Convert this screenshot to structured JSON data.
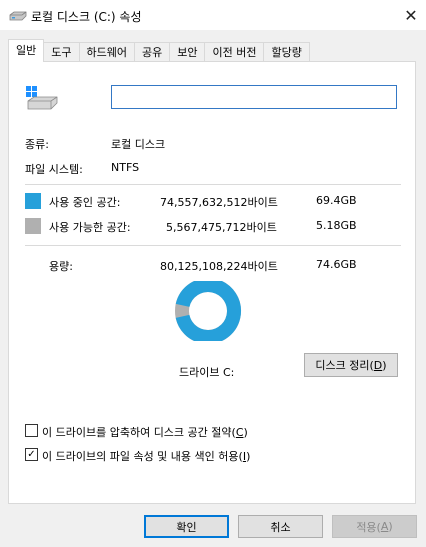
{
  "window": {
    "title": "로컬 디스크 (C:) 속성",
    "close_glyph": "✕"
  },
  "tabs": [
    {
      "label": "일반",
      "active": true
    },
    {
      "label": "도구"
    },
    {
      "label": "하드웨어"
    },
    {
      "label": "공유"
    },
    {
      "label": "보안"
    },
    {
      "label": "이전 버전"
    },
    {
      "label": "할당량"
    }
  ],
  "icons": {
    "title": "drive-icon",
    "drive": "windows-drive-icon",
    "close": "close-icon"
  },
  "name_field": {
    "value": ""
  },
  "info": {
    "type_label": "종류:",
    "type_value": "로컬 디스크",
    "fs_label": "파일 시스템:",
    "fs_value": "NTFS"
  },
  "usage": {
    "used_label": "사용 중인 공간:",
    "used_bytes": "74,557,632,512바이트",
    "used_size": "69.4GB",
    "free_label": "사용 가능한 공간:",
    "free_bytes": "5,567,475,712바이트",
    "free_size": "5.18GB",
    "capacity_label": "용량:",
    "capacity_bytes": "80,125,108,224바이트",
    "capacity_size": "74.6GB",
    "used_fraction": 0.9305
  },
  "colors": {
    "used": "#26a0da",
    "free": "#b0b0b0",
    "accent": "#0078d7"
  },
  "drive_label": "드라이브 C:",
  "cleanup": {
    "label": "디스크 정리(",
    "key": "D",
    "suffix": ")"
  },
  "options": {
    "compress": {
      "label": "이 드라이브를 압축하여 디스크 공간 절약(",
      "key": "C",
      "suffix": ")",
      "checked": false
    },
    "index": {
      "label": "이 드라이브의 파일 속성 및 내용 색인 허용(",
      "key": "I",
      "suffix": ")",
      "checked": true
    }
  },
  "buttons": {
    "ok": "확인",
    "cancel": "취소",
    "apply_label": "적용(",
    "apply_key": "A",
    "apply_suffix": ")"
  }
}
